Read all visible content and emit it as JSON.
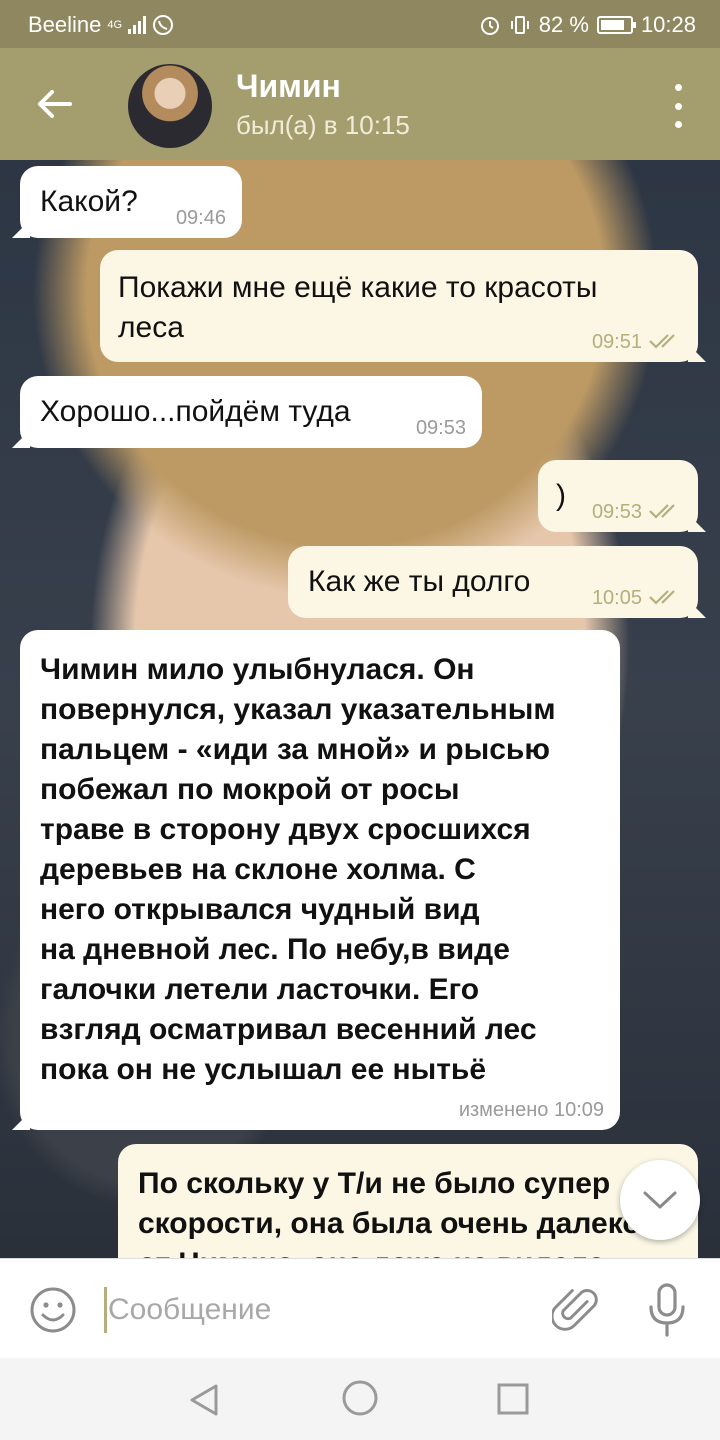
{
  "status_bar": {
    "carrier": "Beeline",
    "network": "4G",
    "battery_percent": "82 %",
    "battery_level": 0.82,
    "time": "10:28"
  },
  "header": {
    "contact_name": "Чимин",
    "last_seen": "был(а) в 10:15",
    "icons": {
      "back": "arrow-left-icon",
      "menu": "more-vertical-icon"
    }
  },
  "messages": [
    {
      "direction": "in",
      "text": "Какой?",
      "time": "09:46"
    },
    {
      "direction": "out",
      "text_lines": [
        "Покажи мне ещё какие то красоты",
        "леса"
      ],
      "time": "09:51",
      "read": true
    },
    {
      "direction": "in",
      "text": "Хорошо...пойдём туда",
      "time": "09:53"
    },
    {
      "direction": "out",
      "text": ")",
      "time": "09:53",
      "read": true
    },
    {
      "direction": "out",
      "text": "Как же ты долго",
      "time": "10:05",
      "read": true
    },
    {
      "direction": "in",
      "text_lines": [
        "Чимин мило улыбнулася. Он",
        "повернулся, указал указательным",
        "пальцем - «иди за мной» и рысью",
        "побежал по мокрой от росы",
        "траве в сторону двух сросшихся",
        "деревьев на склоне холма. С",
        "него открывался чудный вид",
        "на дневной лес. По небу,в виде",
        "галочки летели ласточки. Его",
        "взгляд осматривал весенний лес",
        "пока он не услышал ее нытьё"
      ],
      "time": "изменено 10:09"
    },
    {
      "direction": "out",
      "text_lines": [
        "По скольку у Т/и не было супер",
        "скорости, она была очень далеко",
        "от Чимина, она даже не видела"
      ]
    }
  ],
  "composer": {
    "placeholder": "Сообщение",
    "icons": {
      "emoji": "smile-icon",
      "attach": "paperclip-icon",
      "mic": "microphone-icon"
    }
  },
  "colors": {
    "header": "#a49d6e",
    "status_bar": "#8f8760",
    "outgoing_bubble": "#fbf7e4",
    "incoming_bubble": "#ffffff",
    "check_color": "#b7ad7d"
  }
}
